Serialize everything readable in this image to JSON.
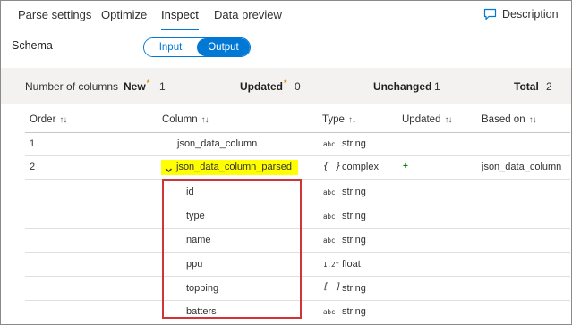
{
  "tabs": [
    {
      "label": "Parse settings"
    },
    {
      "label": "Optimize"
    },
    {
      "label": "Inspect",
      "active": true
    },
    {
      "label": "Data preview"
    }
  ],
  "description_button": {
    "label": "Description",
    "icon": "comment-icon"
  },
  "schema": {
    "label": "Schema",
    "toggle": {
      "input_label": "Input",
      "output_label": "Output",
      "selected": "Output"
    }
  },
  "summary": {
    "number_of_columns_label": "Number of columns",
    "new_label": "New",
    "new_value": "1",
    "updated_label": "Updated",
    "updated_value": "0",
    "unchanged_label": "Unchanged",
    "unchanged_value": "1",
    "total_label": "Total",
    "total_value": "2",
    "star": "*"
  },
  "table": {
    "headers": {
      "order": "Order",
      "column": "Column",
      "type": "Type",
      "updated": "Updated",
      "based_on": "Based on",
      "sort_glyph": "↑↓"
    },
    "rows": [
      {
        "order": "1",
        "column": "json_data_column",
        "type_icon": "abc",
        "type": "string",
        "updated": "",
        "based_on": ""
      },
      {
        "order": "2",
        "column": "json_data_column_parsed",
        "type_icon": "{ }",
        "type": "complex",
        "updated": "+",
        "based_on": "json_data_column"
      }
    ],
    "children": [
      {
        "column": "id",
        "type_icon": "abc",
        "type": "string"
      },
      {
        "column": "type",
        "type_icon": "abc",
        "type": "string"
      },
      {
        "column": "name",
        "type_icon": "abc",
        "type": "string"
      },
      {
        "column": "ppu",
        "type_icon": "1.2f",
        "type": "float"
      },
      {
        "column": "topping",
        "type_icon": "[ ]",
        "type": "string"
      },
      {
        "column": "batters",
        "type_icon": "abc",
        "type": "string"
      }
    ]
  },
  "colors": {
    "accent": "#0078d4",
    "highlight": "#ffff00",
    "callout": "#d13438",
    "new_star": "#d29200",
    "added_plus": "#107c10"
  }
}
